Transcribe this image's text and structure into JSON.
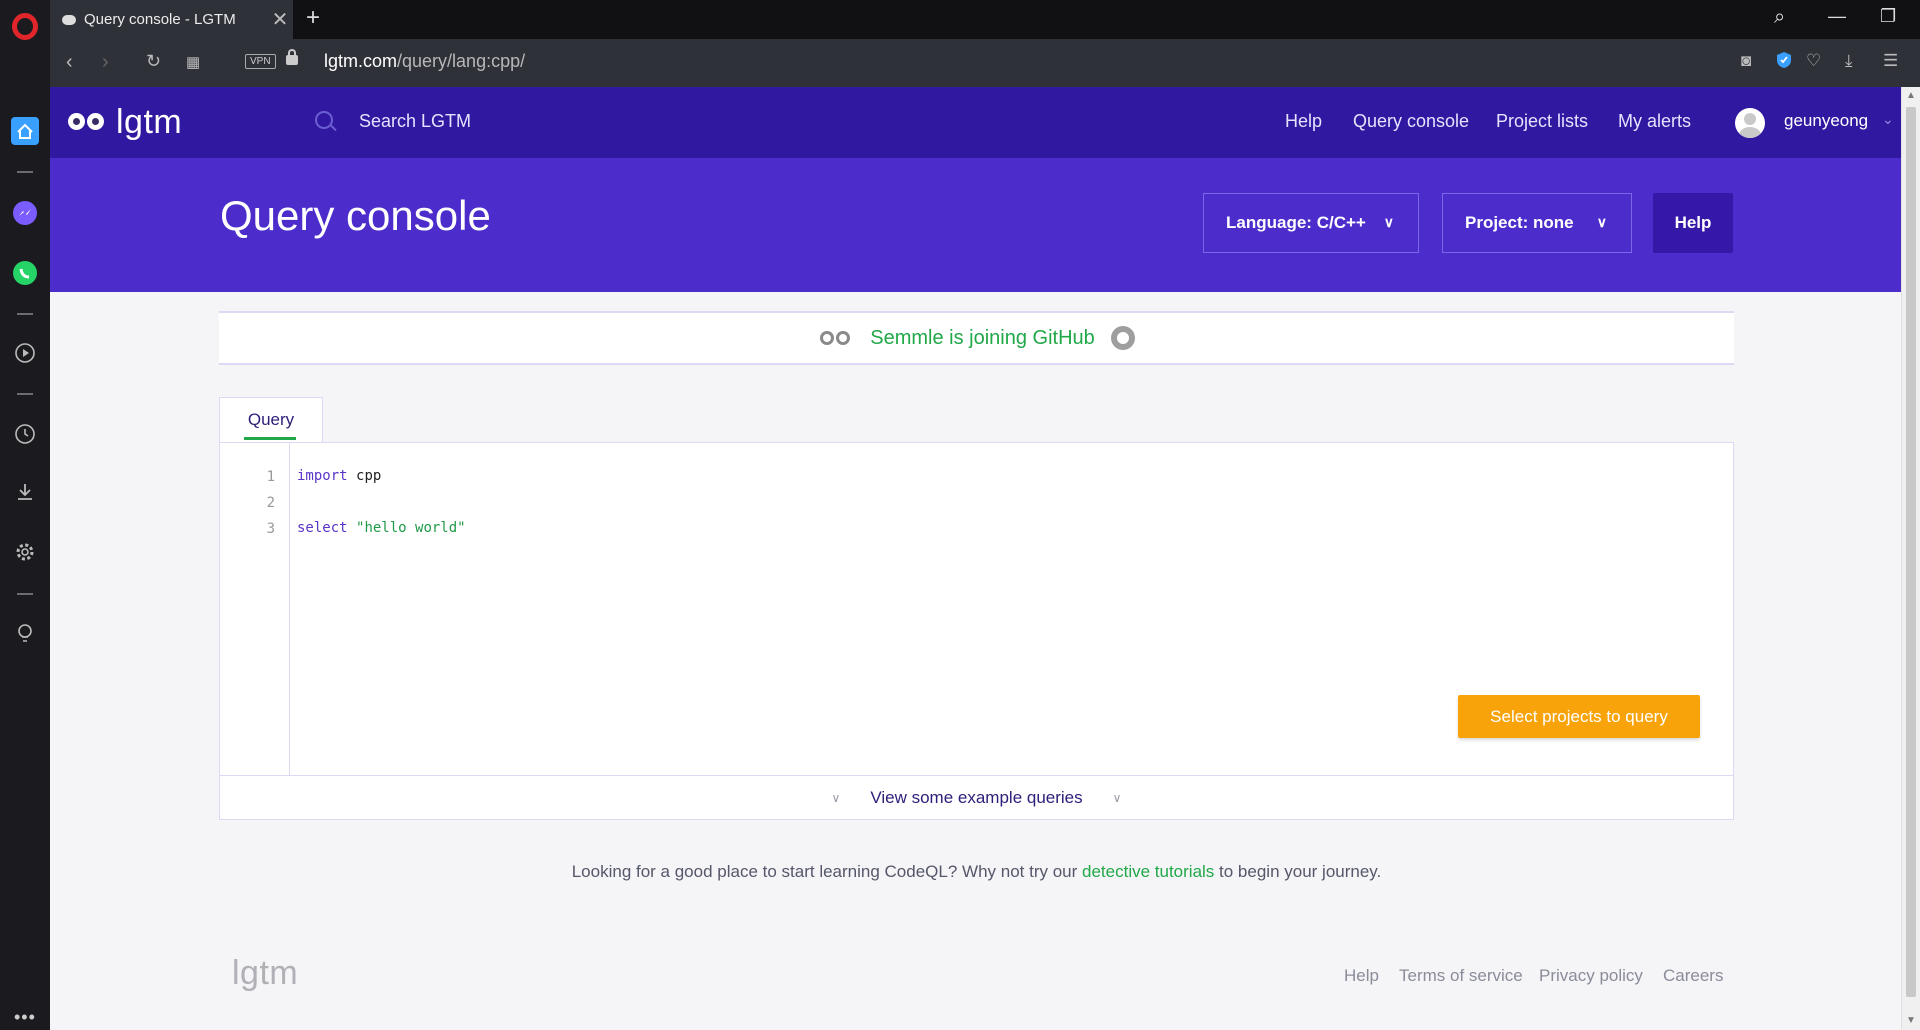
{
  "browser": {
    "tab_title": "Query console - LGTM",
    "url_domain": "lgtm.com",
    "url_path": "/query/lang:cpp/",
    "vpn_label": "VPN"
  },
  "topnav": {
    "brand": "lgtm",
    "search_placeholder": "Search LGTM",
    "links": [
      "Help",
      "Query console",
      "Project lists",
      "My alerts"
    ],
    "username": "geunyeong"
  },
  "hero": {
    "title": "Query console",
    "language_label": "Language:",
    "language_value": "C/C++",
    "project_label": "Project:",
    "project_value": "none",
    "help_label": "Help"
  },
  "banner": {
    "text": "Semmle is joining GitHub"
  },
  "editor": {
    "tab_label": "Query",
    "line_numbers": [
      "1",
      "2",
      "3"
    ],
    "line1_kw": "import",
    "line1_id": "cpp",
    "line3_kw": "select",
    "line3_str": "\"hello world\"",
    "select_button": "Select projects to query",
    "examples_label": "View some example queries"
  },
  "learn": {
    "before": "Looking for a good place to start learning CodeQL? Why not try our ",
    "link": "detective tutorials",
    "after": " to begin your journey."
  },
  "footer": {
    "logo": "lgtm",
    "links": [
      "Help",
      "Terms of service",
      "Privacy policy",
      "Careers"
    ]
  },
  "colors": {
    "nav_bg": "#3018a0",
    "hero_bg": "#4c2dcc",
    "accent_green": "#21a849",
    "select_orange": "#f9a30a"
  }
}
